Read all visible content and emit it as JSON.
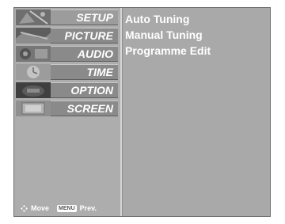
{
  "menu": {
    "items": [
      {
        "label": "SETUP",
        "icon": "satellite-dish-thumbnail-icon",
        "selected": true
      },
      {
        "label": "PICTURE",
        "icon": "picture-thumbnail-icon",
        "selected": false
      },
      {
        "label": "AUDIO",
        "icon": "audio-thumbnail-icon",
        "selected": false
      },
      {
        "label": "TIME",
        "icon": "clock-thumbnail-icon",
        "selected": false
      },
      {
        "label": "OPTION",
        "icon": "option-thumbnail-icon",
        "selected": false
      },
      {
        "label": "SCREEN",
        "icon": "screen-thumbnail-icon",
        "selected": false
      }
    ]
  },
  "submenu": {
    "items": [
      "Auto Tuning",
      "Manual Tuning",
      "Programme Edit"
    ]
  },
  "footer": {
    "move_label": "Move",
    "menu_key": "MENU",
    "prev_label": "Prev.",
    "move_icon": "four-way-arrow-icon"
  },
  "colors": {
    "osd_background": "#a9a9a9",
    "label_box": "#8a8a8a",
    "text": "#ffffff"
  }
}
